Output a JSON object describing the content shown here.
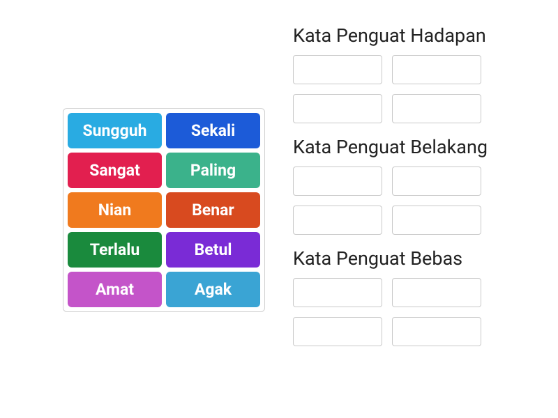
{
  "word_bank": [
    {
      "label": "Sungguh",
      "color": "#29abe2"
    },
    {
      "label": "Sekali",
      "color": "#1c5bd8"
    },
    {
      "label": "Sangat",
      "color": "#e21f4f"
    },
    {
      "label": "Paling",
      "color": "#3bb28b"
    },
    {
      "label": "Nian",
      "color": "#f07a1e"
    },
    {
      "label": "Benar",
      "color": "#d84a1f"
    },
    {
      "label": "Terlalu",
      "color": "#1a8a3d"
    },
    {
      "label": "Betul",
      "color": "#7a2bd6"
    },
    {
      "label": "Amat",
      "color": "#c454c9"
    },
    {
      "label": "Agak",
      "color": "#3aa4d4"
    }
  ],
  "categories": [
    {
      "title": "Kata Penguat Hadapan"
    },
    {
      "title": "Kata Penguat Belakang"
    },
    {
      "title": "Kata Penguat Bebas"
    }
  ]
}
